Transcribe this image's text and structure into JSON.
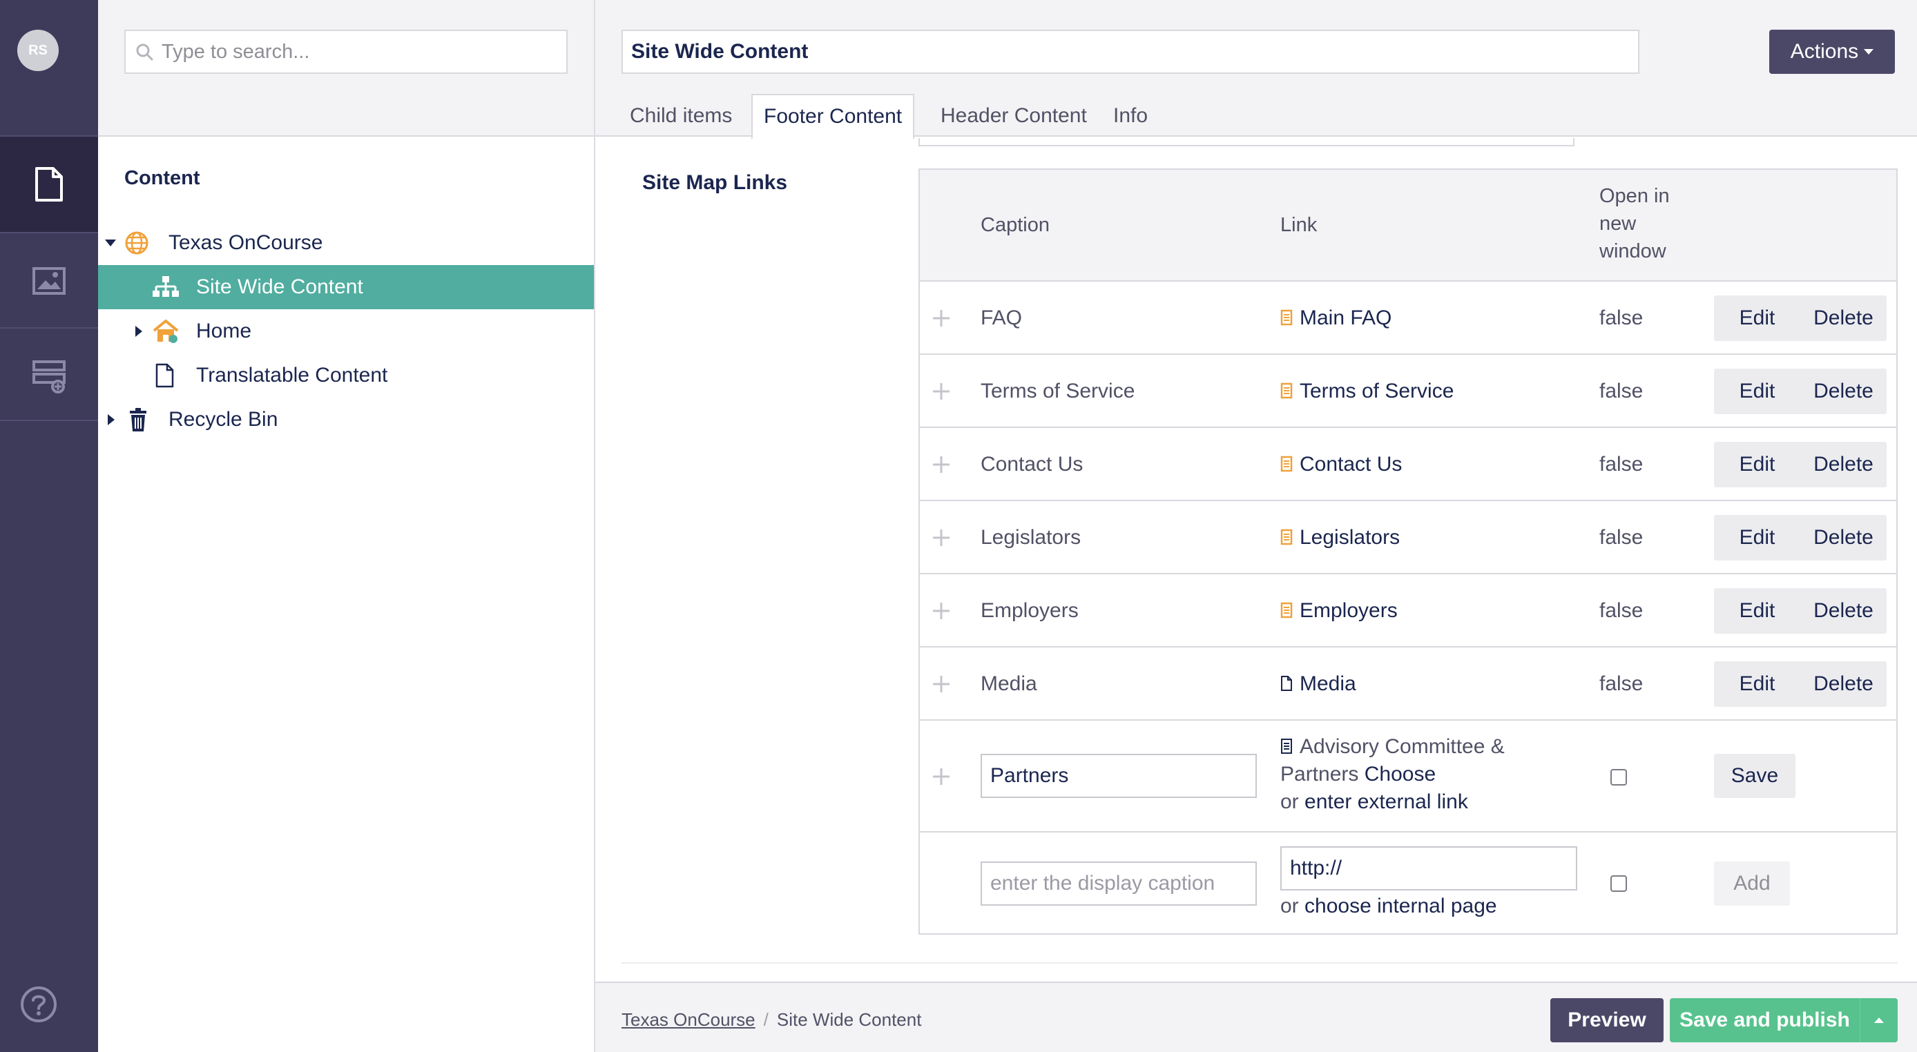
{
  "user": {
    "initials": "RS"
  },
  "colors": {
    "rail": "#3e3a5a",
    "accent_active": "#50ad9f",
    "publish": "#57c28d",
    "dark_button": "#4b4867",
    "link_icon": "#f0a13a"
  },
  "rail": {
    "sections": [
      {
        "name": "content",
        "icon": "document-icon",
        "active": true
      },
      {
        "name": "media",
        "icon": "image-icon",
        "active": false
      },
      {
        "name": "forms",
        "icon": "forms-icon",
        "active": false
      }
    ],
    "help_icon": "help-icon"
  },
  "tree": {
    "search_placeholder": "Type to search...",
    "title": "Content",
    "nodes": [
      {
        "label": "Texas OnCourse",
        "icon": "globe-icon",
        "expanded": true
      },
      {
        "label": "Site Wide Content",
        "icon": "sitemap-icon",
        "active": true
      },
      {
        "label": "Home",
        "icon": "home-icon",
        "expanded": false
      },
      {
        "label": "Translatable Content",
        "icon": "document-icon"
      },
      {
        "label": "Recycle Bin",
        "icon": "trash-icon",
        "expanded": false
      }
    ]
  },
  "editor": {
    "node_name": "Site Wide Content",
    "actions_label": "Actions",
    "tabs": [
      "Child items",
      "Footer Content",
      "Header Content",
      "Info"
    ],
    "active_tab": "Footer Content",
    "property_label": "Site Map Links",
    "columns": {
      "caption": "Caption",
      "link": "Link",
      "open_new_window": "Open in\nnew\nwindow"
    },
    "rows": [
      {
        "caption": "FAQ",
        "link": "Main FAQ",
        "link_icon": "page-icon",
        "new_window": "false",
        "edit": "Edit",
        "delete": "Delete"
      },
      {
        "caption": "Terms of Service",
        "link": "Terms of Service",
        "link_icon": "page-icon",
        "new_window": "false",
        "edit": "Edit",
        "delete": "Delete"
      },
      {
        "caption": "Contact Us",
        "link": "Contact Us",
        "link_icon": "page-icon",
        "new_window": "false",
        "edit": "Edit",
        "delete": "Delete"
      },
      {
        "caption": "Legislators",
        "link": "Legislators",
        "link_icon": "page-icon",
        "new_window": "false",
        "edit": "Edit",
        "delete": "Delete"
      },
      {
        "caption": "Employers",
        "link": "Employers",
        "link_icon": "page-icon",
        "new_window": "false",
        "edit": "Edit",
        "delete": "Delete"
      },
      {
        "caption": "Media",
        "link": "Media",
        "link_icon": "file-icon",
        "new_window": "false",
        "edit": "Edit",
        "delete": "Delete"
      }
    ],
    "editing_row": {
      "caption_value": "Partners",
      "link_line1": "Advisory Committee &",
      "link_line2": "Partners",
      "choose": "Choose",
      "or_text": "or",
      "external_link": "enter external link",
      "save_label": "Save"
    },
    "new_row": {
      "caption_placeholder": "enter the display caption",
      "link_value": "http://",
      "or_text": "or",
      "choose_internal": "choose internal page",
      "add_label": "Add"
    }
  },
  "footer": {
    "breadcrumb": [
      "Texas OnCourse",
      "Site Wide Content"
    ],
    "breadcrumb_separator": "/",
    "preview_label": "Preview",
    "publish_label": "Save and publish"
  }
}
